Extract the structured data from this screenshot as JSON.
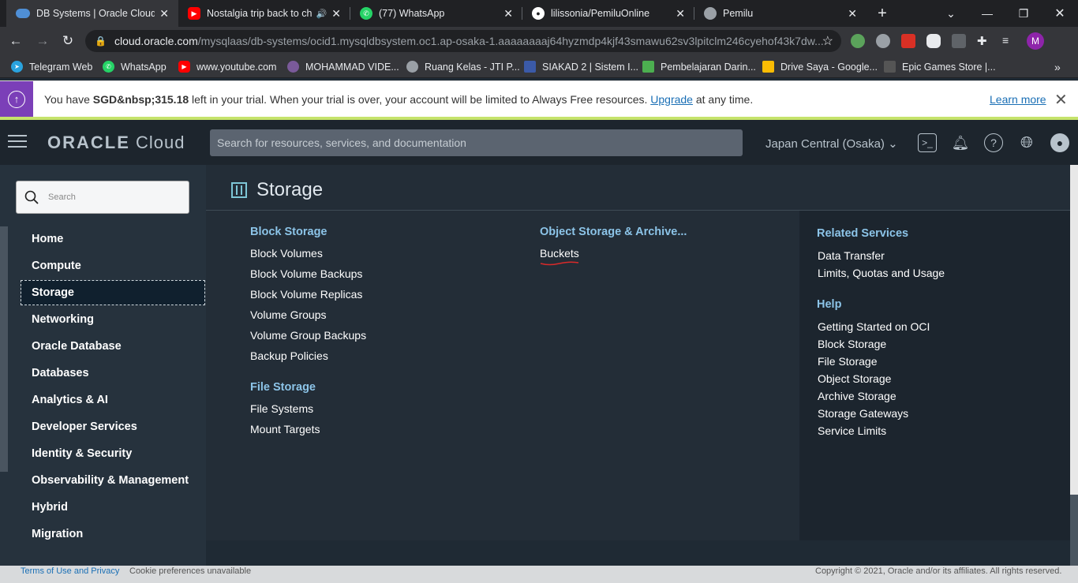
{
  "browser": {
    "tabs": [
      {
        "title": "DB Systems | Oracle Cloud In",
        "icon": "cloud-icon",
        "color": "#4f8fd6"
      },
      {
        "title": "Nostalgia trip back to chi",
        "icon": "youtube-icon",
        "color": "#ff0000"
      },
      {
        "title": "(77) WhatsApp",
        "icon": "whatsapp-icon",
        "color": "#25d366"
      },
      {
        "title": "lilissonia/PemiluOnline",
        "icon": "github-icon",
        "color": "#ffffff"
      },
      {
        "title": "Pemilu",
        "icon": "globe-icon",
        "color": "#9aa0a6"
      }
    ],
    "url_host": "cloud.oracle.com",
    "url_path": "/mysqlaas/db-systems/ocid1.mysqldbsystem.oc1.ap-osaka-1.aaaaaaaaj64hyzmdp4kjf43smawu62sv3lpitclm246cyehof43k7dw...",
    "profile_initial": "M",
    "bookmarks": [
      {
        "label": "Telegram Web",
        "icon": "telegram-icon",
        "color": "#2aa3df"
      },
      {
        "label": "WhatsApp",
        "icon": "whatsapp-icon",
        "color": "#25d366"
      },
      {
        "label": "www.youtube.com",
        "icon": "youtube-icon",
        "color": "#ff0000"
      },
      {
        "label": "MOHAMMAD VIDE...",
        "icon": "seal-icon",
        "color": "#7a5a9a"
      },
      {
        "label": "Ruang Kelas - JTI P...",
        "icon": "globe-icon",
        "color": "#9aa0a6"
      },
      {
        "label": "SIAKAD 2 | Sistem I...",
        "icon": "university-icon",
        "color": "#3b5aa8"
      },
      {
        "label": "Pembelajaran Darin...",
        "icon": "school-icon",
        "color": "#4caf50"
      },
      {
        "label": "Drive Saya - Google...",
        "icon": "drive-icon",
        "color": "#fbbc04"
      },
      {
        "label": "Epic Games Store |...",
        "icon": "epic-icon",
        "color": "#555555"
      }
    ]
  },
  "trial": {
    "prefix": "You have ",
    "amount": "SGD&nbsp;315.18",
    "middle": " left in your trial. When your trial is over, your account will be limited to Always Free resources. ",
    "upgrade": "Upgrade",
    "suffix": " at any time.",
    "learn_more": "Learn more"
  },
  "header": {
    "brand": "ORACLE",
    "product": " Cloud",
    "search_placeholder": "Search for resources, services, and documentation",
    "region": "Japan Central (Osaka)"
  },
  "sidebar": {
    "search_placeholder": "Search",
    "items": [
      {
        "label": "Home",
        "active": false
      },
      {
        "label": "Compute",
        "active": false
      },
      {
        "label": "Storage",
        "active": true
      },
      {
        "label": "Networking",
        "active": false
      },
      {
        "label": "Oracle Database",
        "active": false
      },
      {
        "label": "Databases",
        "active": false
      },
      {
        "label": "Analytics & AI",
        "active": false
      },
      {
        "label": "Developer Services",
        "active": false
      },
      {
        "label": "Identity & Security",
        "active": false
      },
      {
        "label": "Observability & Management",
        "active": false
      },
      {
        "label": "Hybrid",
        "active": false
      },
      {
        "label": "Migration",
        "active": false
      }
    ]
  },
  "main": {
    "title": "Storage",
    "block_storage": {
      "heading": "Block Storage",
      "links": [
        "Block Volumes",
        "Block Volume Backups",
        "Block Volume Replicas",
        "Volume Groups",
        "Volume Group Backups",
        "Backup Policies"
      ]
    },
    "file_storage": {
      "heading": "File Storage",
      "links": [
        "File Systems",
        "Mount Targets"
      ]
    },
    "object_storage": {
      "heading": "Object Storage & Archive...",
      "links": [
        "Buckets"
      ]
    },
    "related": {
      "heading": "Related Services",
      "links": [
        "Data Transfer",
        "Limits, Quotas and Usage"
      ]
    },
    "help": {
      "heading": "Help",
      "links": [
        "Getting Started on OCI",
        "Block Storage",
        "File Storage",
        "Object Storage",
        "Archive Storage",
        "Storage Gateways",
        "Service Limits"
      ]
    }
  },
  "footer": {
    "terms": "Terms of Use and Privacy",
    "cookie": "Cookie preferences unavailable",
    "copyright": "Copyright © 2021, Oracle and/or its affiliates. All rights reserved."
  }
}
